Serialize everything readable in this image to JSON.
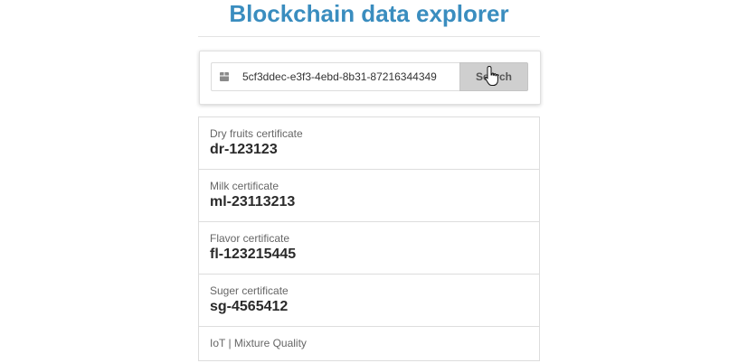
{
  "header": {
    "title": "Blockchain data explorer"
  },
  "search": {
    "value": "5cf3ddec-e3f3-4ebd-8b31-87216344349",
    "button_label": "Search",
    "icon": "cube-icon"
  },
  "results": [
    {
      "label": "Dry fruits certificate",
      "value": "dr-123123"
    },
    {
      "label": "Milk certificate",
      "value": "ml-23113213"
    },
    {
      "label": "Flavor certificate",
      "value": "fl-123215445"
    },
    {
      "label": "Suger certificate",
      "value": "sg-4565412"
    }
  ],
  "footer": {
    "text": "IoT | Mixture Quality"
  },
  "colors": {
    "title": "#3a8dbf",
    "button_bg": "#cfcfcf"
  }
}
